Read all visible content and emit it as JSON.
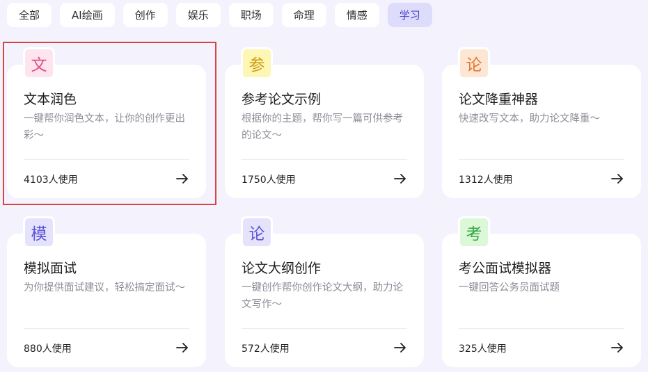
{
  "tabs": [
    {
      "label": "全部"
    },
    {
      "label": "AI绘画"
    },
    {
      "label": "创作"
    },
    {
      "label": "娱乐"
    },
    {
      "label": "职场"
    },
    {
      "label": "命理"
    },
    {
      "label": "情感"
    },
    {
      "label": "学习",
      "active": true
    }
  ],
  "cards": [
    {
      "badge": "文",
      "badge_bg": "#fde4ee",
      "badge_color": "#e04f86",
      "title": "文本润色",
      "desc": "一键帮你润色文本，让你的创作更出彩～",
      "usage": "4103人使用"
    },
    {
      "badge": "参",
      "badge_bg": "#fdf7b3",
      "badge_color": "#c99a12",
      "title": "参考论文示例",
      "desc": "根据你的主题，帮你写一篇可供参考的论文～",
      "usage": "1750人使用"
    },
    {
      "badge": "论",
      "badge_bg": "#fde6d4",
      "badge_color": "#e6772e",
      "title": "论文降重神器",
      "desc": "快速改写文本，助力论文降重～",
      "usage": "1312人使用"
    },
    {
      "badge": "模",
      "badge_bg": "#e5e3fc",
      "badge_color": "#5b55d6",
      "title": "模拟面试",
      "desc": "为你提供面试建议，轻松搞定面试～",
      "usage": "880人使用"
    },
    {
      "badge": "论",
      "badge_bg": "#e5e3fc",
      "badge_color": "#5b55d6",
      "title": "论文大纲创作",
      "desc": "一键创作帮你创作论文大纲，助力论文写作～",
      "usage": "572人使用"
    },
    {
      "badge": "考",
      "badge_bg": "#dcf8d9",
      "badge_color": "#34a93e",
      "title": "考公面试模拟器",
      "desc": "一键回答公务员面试题",
      "usage": "325人使用"
    }
  ],
  "colors": {
    "page_bg": "#f3f2fd",
    "active_tab_bg": "#dedcfb",
    "highlight_border": "#d9443f"
  },
  "icons": {
    "card_action": "arrow-right-icon"
  }
}
